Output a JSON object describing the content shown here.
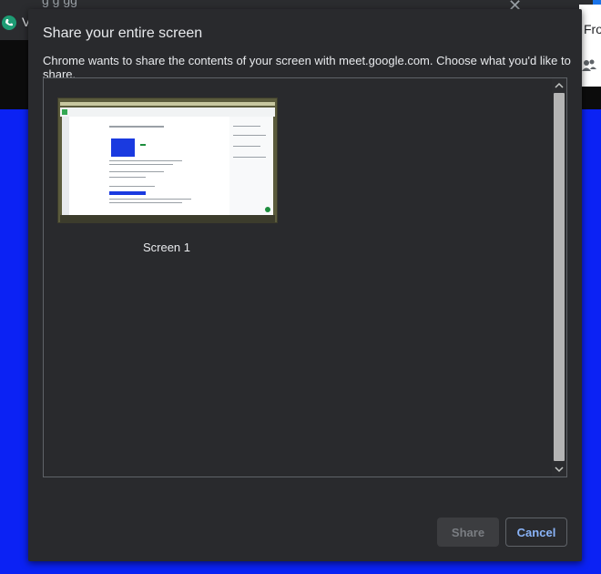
{
  "background": {
    "tab_title_partial": "V",
    "side_text_partial": "Fro"
  },
  "dialog": {
    "title": "Share your entire screen",
    "subtitle": "Chrome wants to share the contents of your screen with meet.google.com. Choose what you'd like to share.",
    "sources": [
      {
        "label": "Screen 1"
      }
    ],
    "buttons": {
      "share": "Share",
      "cancel": "Cancel"
    }
  },
  "colors": {
    "dialog_bg": "#292a2d",
    "accent_blue": "#8ab4f8",
    "page_bg_blue": "#0b22f4"
  }
}
